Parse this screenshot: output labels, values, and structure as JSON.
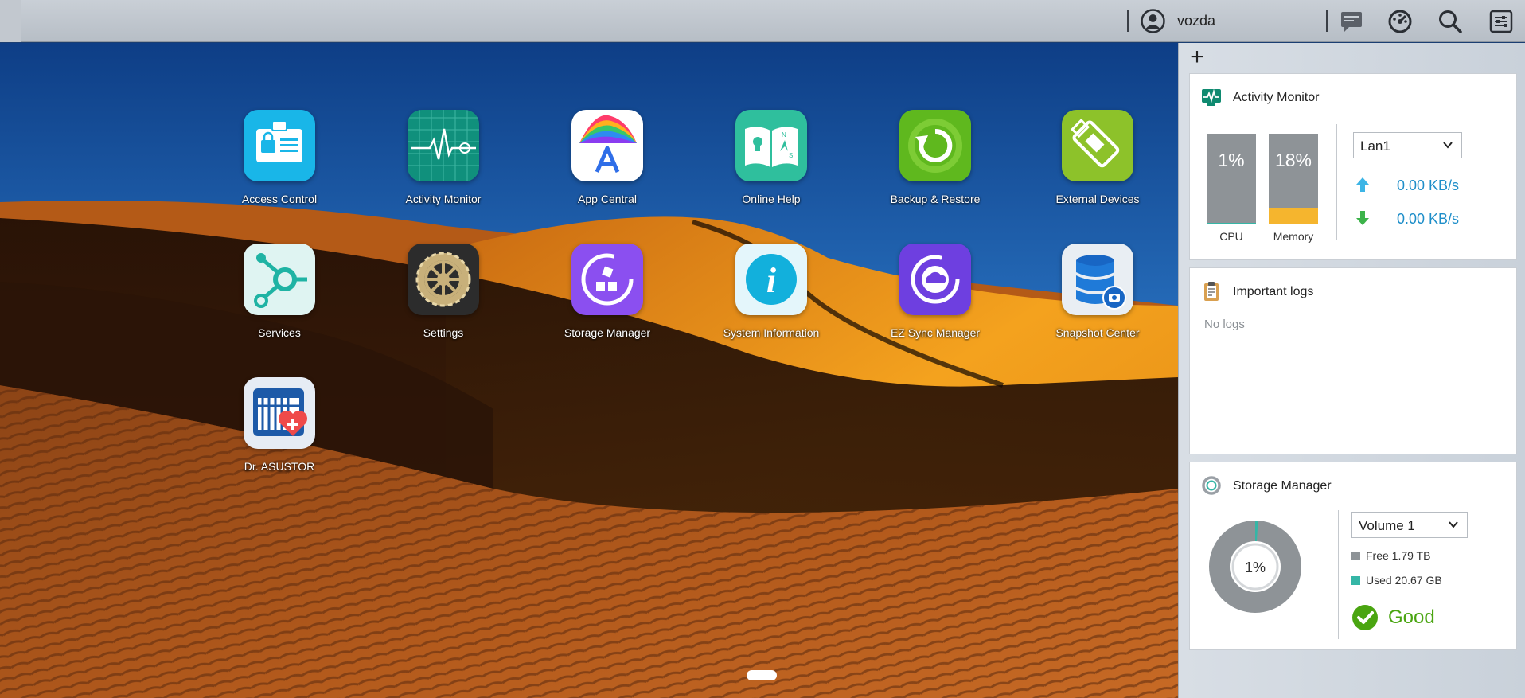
{
  "taskbar": {
    "user_name": "vozda",
    "icons": [
      "user-avatar-icon",
      "notification-icon",
      "dashboard-icon",
      "search-icon",
      "widget-settings-icon"
    ]
  },
  "desktop": {
    "apps": [
      {
        "label": "Access Control",
        "icon": "access-control-icon"
      },
      {
        "label": "Activity Monitor",
        "icon": "activity-monitor-icon"
      },
      {
        "label": "App Central",
        "icon": "app-central-icon"
      },
      {
        "label": "Online Help",
        "icon": "online-help-icon"
      },
      {
        "label": "Backup & Restore",
        "icon": "backup-restore-icon"
      },
      {
        "label": "External Devices",
        "icon": "external-devices-icon"
      },
      {
        "label": "Services",
        "icon": "services-icon"
      },
      {
        "label": "Settings",
        "icon": "settings-gear-icon"
      },
      {
        "label": "Storage Manager",
        "icon": "storage-manager-icon"
      },
      {
        "label": "System Information",
        "icon": "system-information-icon"
      },
      {
        "label": "EZ Sync Manager",
        "icon": "ez-sync-icon"
      },
      {
        "label": "Snapshot Center",
        "icon": "snapshot-center-icon"
      },
      {
        "label": "Dr. ASUSTOR",
        "icon": "dr-asustor-icon"
      }
    ]
  },
  "widgets": {
    "add_label": "+",
    "activity": {
      "title": "Activity Monitor",
      "cpu": {
        "label": "CPU",
        "value_text": "1%",
        "percent": 1
      },
      "memory": {
        "label": "Memory",
        "value_text": "18%",
        "percent": 18
      },
      "network_select": "Lan1",
      "upload": "0.00 KB/s",
      "download": "0.00 KB/s"
    },
    "logs": {
      "title": "Important logs",
      "empty_text": "No logs"
    },
    "storage": {
      "title": "Storage Manager",
      "volume_select": "Volume 1",
      "usage_text": "1%",
      "usage_percent": 1,
      "free": "Free 1.79 TB",
      "used": "Used 20.67 GB",
      "status": "Good"
    }
  },
  "colors": {
    "accent_teal": "#35b6a6",
    "memory_fill": "#f5b52e",
    "meter_gray": "#8e9397",
    "rate_blue": "#1e8ec9",
    "good_green": "#4aa511"
  }
}
